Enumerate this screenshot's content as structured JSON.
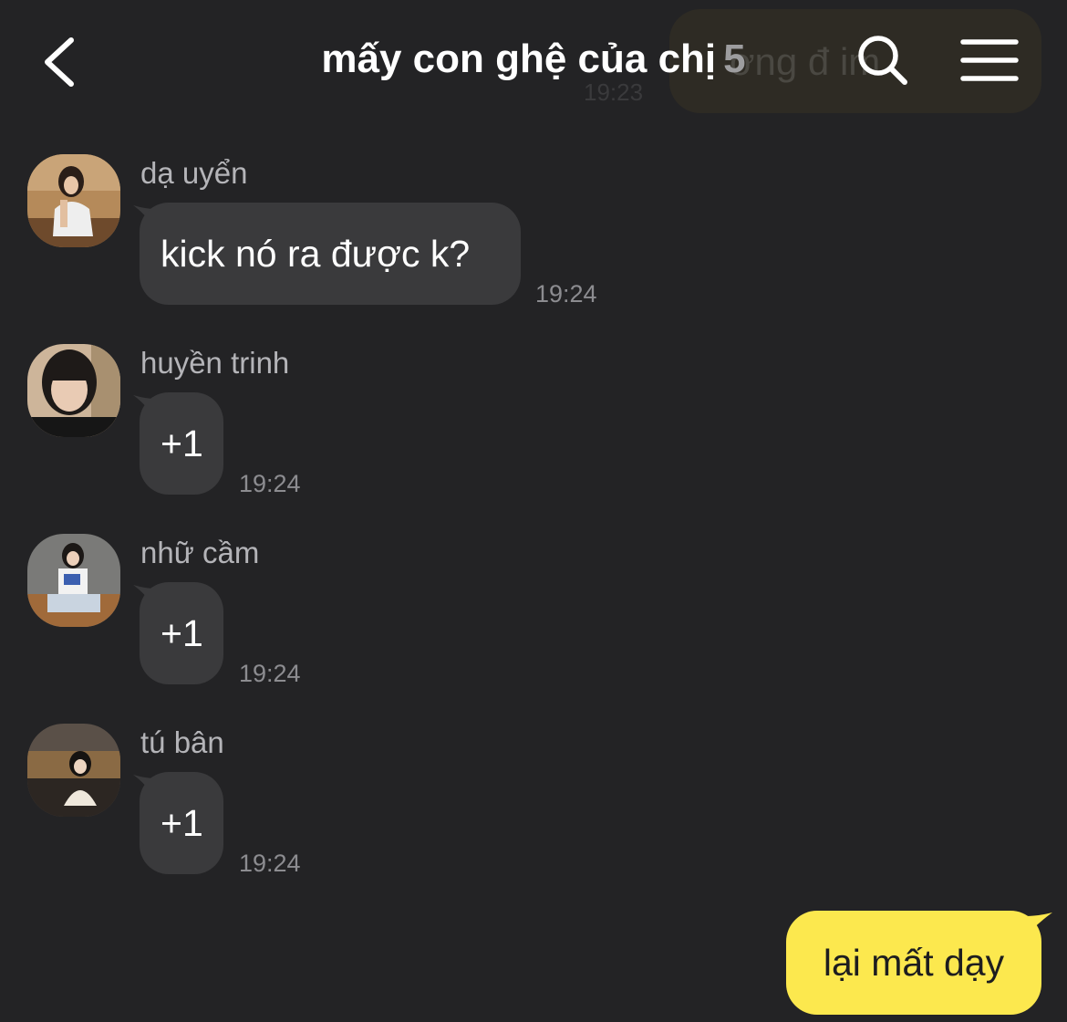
{
  "header": {
    "title": "mấy con ghệ của chị",
    "member_count": "5",
    "back_icon": "chevron-left-icon",
    "search_icon": "search-icon",
    "menu_icon": "menu-icon"
  },
  "pinned_preview": {
    "text": "ơng đ    im",
    "time": "19:23"
  },
  "colors": {
    "background": "#232325",
    "incoming_bubble": "#3a3a3c",
    "outgoing_bubble": "#fce84e",
    "sender_text": "#b4b4b8",
    "time_text": "#8c8c90"
  },
  "messages": [
    {
      "sender": "dạ uyển",
      "text": "kick nó ra được k?",
      "time": "19:24"
    },
    {
      "sender": "huyền trinh",
      "text": "+1",
      "time": "19:24"
    },
    {
      "sender": "nhữ cầm",
      "text": "+1",
      "time": "19:24"
    },
    {
      "sender": "tú bân",
      "text": "+1",
      "time": "19:24"
    }
  ],
  "my_message": {
    "text": "lại mất dạy"
  }
}
